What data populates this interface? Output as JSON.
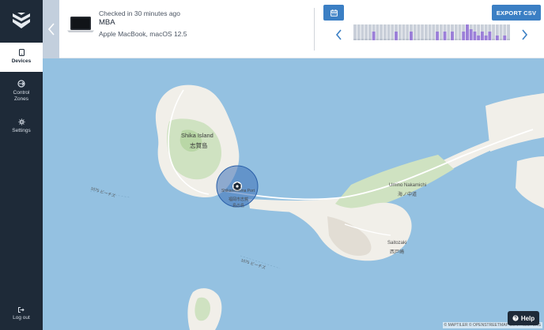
{
  "sidebar": {
    "items": [
      {
        "label": "Devices"
      },
      {
        "label": "Control Zones"
      },
      {
        "label": "Settings"
      }
    ],
    "logout_label": "Log out"
  },
  "device": {
    "checked": "Checked in 30 minutes ago",
    "name": "MBA",
    "model": "Apple MacBook, macOS 12.5"
  },
  "toolbar": {
    "export_label": "EXPORT CSV"
  },
  "timeline": {
    "levels": [
      0.1,
      0.1,
      0.1,
      0.1,
      0.1,
      0.55,
      0.1,
      0.1,
      0.1,
      0.1,
      0.1,
      0.55,
      0.1,
      0.1,
      0.1,
      0.55,
      0.1,
      0.1,
      0.1,
      0.1,
      0.1,
      0.1,
      0.55,
      0.1,
      0.55,
      0.1,
      0.55,
      0.1,
      0.1,
      0.55,
      1.0,
      0.7,
      0.55,
      0.3,
      0.55,
      0.3,
      0.55,
      0.1,
      0.3,
      0.1,
      0.3,
      0.1
    ],
    "accent": "#9b7fd8",
    "base": "#c9cfd9"
  },
  "map": {
    "labels": {
      "island_en": "Shika Island",
      "island_jp": "志賀島",
      "marker_en": "Shikanoshima Port",
      "marker_jp1": "福岡市志賀",
      "marker_jp2": "島の島",
      "road1": "1075 ビーチズ",
      "road2": "1075 ビーチズ",
      "umino_en": "Umino Nakamichi",
      "umino_jp": "海ノ中道",
      "saitozaki_en": "Saitozaki",
      "saitozaki_jp": "西戸崎"
    },
    "attribution": "© MAPTILER © OPENSTREETMAP CONTRIBUTORS"
  },
  "help": {
    "label": "Help"
  }
}
